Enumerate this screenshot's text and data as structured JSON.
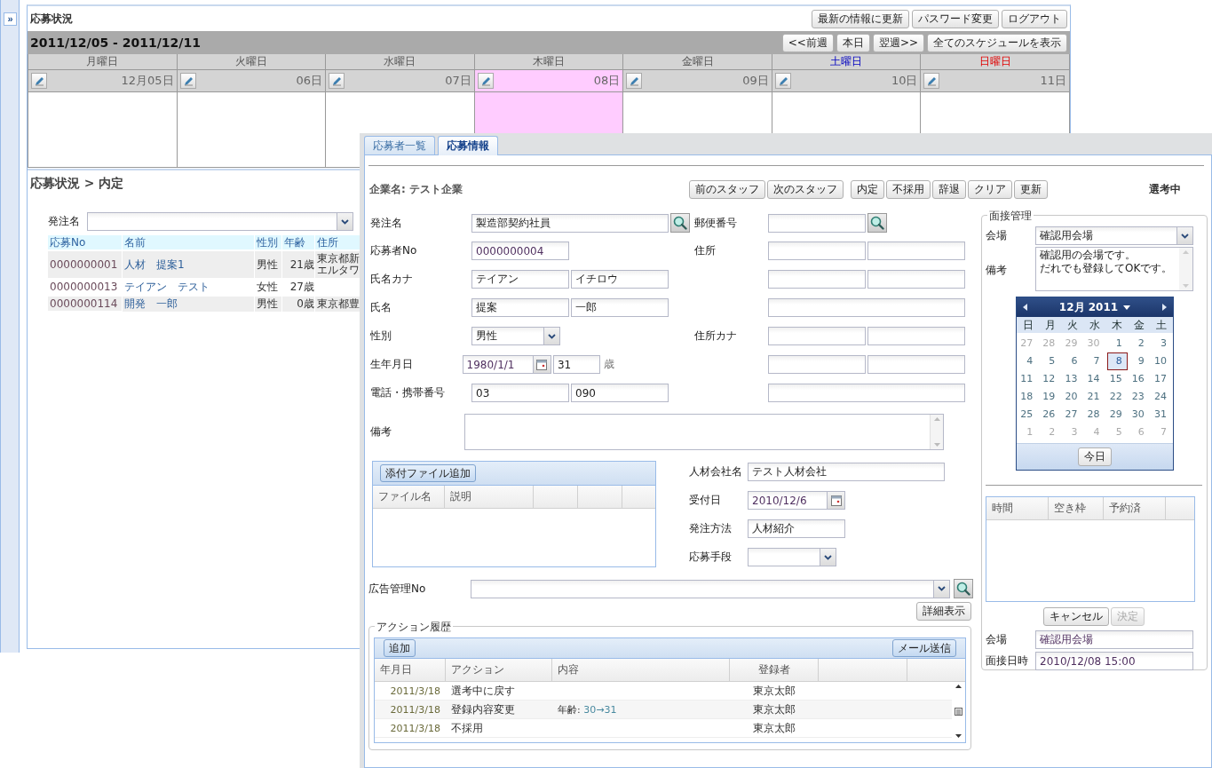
{
  "sidebar_toggle": {
    "label": "»"
  },
  "schedule": {
    "title": "応募状況",
    "buttons": [
      "最新の情報に更新",
      "パスワード変更",
      "ログアウト"
    ],
    "range": "2011/12/05 - 2011/12/11",
    "nav_buttons": [
      "<<前週",
      "本日",
      "翌週>>",
      "全てのスケジュールを表示"
    ],
    "days": [
      {
        "weekday": "月曜日",
        "date": "12月05日",
        "kind": "weekday",
        "selected": false
      },
      {
        "weekday": "火曜日",
        "date": "06日",
        "kind": "weekday",
        "selected": false
      },
      {
        "weekday": "水曜日",
        "date": "07日",
        "kind": "weekday",
        "selected": false
      },
      {
        "weekday": "木曜日",
        "date": "08日",
        "kind": "weekday",
        "selected": true
      },
      {
        "weekday": "金曜日",
        "date": "09日",
        "kind": "weekday",
        "selected": false
      },
      {
        "weekday": "土曜日",
        "date": "10日",
        "kind": "saturday",
        "selected": false
      },
      {
        "weekday": "日曜日",
        "date": "11日",
        "kind": "sunday",
        "selected": false
      }
    ]
  },
  "status": {
    "breadcrumb": "応募状況 > 内定",
    "filter_label": "発注名",
    "columns": [
      "応募No",
      "名前",
      "性別",
      "年齢",
      "住所"
    ],
    "rows": [
      {
        "no": "0000000001",
        "name": "人材　提案1",
        "gender": "男性",
        "age": "21歳",
        "address": [
          "東京都新",
          "エルタワ"
        ]
      },
      {
        "no": "0000000013",
        "name": "テイアン　テスト",
        "gender": "女性",
        "age": "27歳"
      },
      {
        "no": "0000000114",
        "name": "開発　一郎",
        "gender": "男性",
        "age": "0歳",
        "address": [
          "東京都豊"
        ]
      }
    ]
  },
  "dialog": {
    "tabs": [
      {
        "label": "応募者一覧",
        "selected": false
      },
      {
        "label": "応募情報",
        "selected": true
      }
    ],
    "company": "企業名: テスト企業",
    "button_groups": [
      [
        "前のスタッフ",
        "次のスタッフ"
      ],
      [
        "内定",
        "不採用",
        "辞退",
        "クリア",
        "更新"
      ]
    ],
    "state": "選考中",
    "person_fields": [
      {
        "label": "発注名",
        "kind": "search",
        "values": [
          "製造部契約社員"
        ]
      },
      {
        "label": "応募者No",
        "kind": "single",
        "values": [
          "0000000004"
        ]
      },
      {
        "label": "氏名カナ",
        "kind": "pair",
        "values": [
          "テイアン",
          "イチロウ"
        ]
      },
      {
        "label": "氏名",
        "kind": "pair",
        "values": [
          "提案",
          "一郎"
        ]
      },
      {
        "label": "性別",
        "kind": "select",
        "values": [
          "男性"
        ]
      },
      {
        "label": "生年月日",
        "kind": "date_age",
        "values": [
          "1980/1/1",
          "31"
        ],
        "suffix": "歳"
      },
      {
        "label": "電話・携帯番号",
        "kind": "pair",
        "values": [
          "03",
          "090"
        ]
      }
    ],
    "address_fields": [
      {
        "label": "郵便番号",
        "kind": "search"
      },
      {
        "label": "住所",
        "kind": "pair"
      },
      {
        "kind": "pair"
      },
      {
        "kind": "wide"
      },
      {
        "label": "住所カナ",
        "kind": "pair"
      },
      {
        "kind": "pair"
      },
      {
        "kind": "wide"
      }
    ],
    "remarks_label": "備考",
    "attachments": {
      "button": "添付ファイル追加",
      "columns": [
        "ファイル名",
        "説明"
      ]
    },
    "agency_fields": [
      {
        "label": "人材会社名",
        "kind": "wide",
        "value": "テスト人材会社"
      },
      {
        "label": "受付日",
        "kind": "date",
        "value": "2010/12/6"
      },
      {
        "label": "発注方法",
        "kind": "short",
        "value": "人材紹介"
      },
      {
        "label": "応募手段",
        "kind": "select"
      }
    ],
    "ad": {
      "label": "広告管理No",
      "detail_button": "詳細表示"
    },
    "history": {
      "title": "アクション履歴",
      "add_button": "追加",
      "mail_button": "メール送信",
      "columns": [
        "年月日",
        "アクション",
        "内容",
        "登録者"
      ],
      "rows": [
        {
          "date": "2011/3/18",
          "action": "選考中に戻す",
          "registrant": "東京太郎"
        },
        {
          "date": "2011/3/18",
          "action": "登録内容変更",
          "content_label": "年齢:",
          "content_value": "30→31",
          "registrant": "東京太郎"
        },
        {
          "date": "2011/3/18",
          "action": "不採用",
          "registrant": "東京太郎"
        }
      ]
    },
    "interview": {
      "title": "面接管理",
      "venue_label": "会場",
      "venue": "確認用会場",
      "note_label": "備考",
      "note_lines": [
        "確認用の会場です。",
        "だれでも登録してOKです。"
      ],
      "calendar": {
        "month": "12月 2011",
        "weekdays": [
          "日",
          "月",
          "火",
          "水",
          "木",
          "金",
          "土"
        ],
        "today_button": "今日",
        "days": [
          {
            "day": "27",
            "muted": true,
            "selected": false
          },
          {
            "day": "28",
            "muted": true,
            "selected": false
          },
          {
            "day": "29",
            "muted": true,
            "selected": false
          },
          {
            "day": "30",
            "muted": true,
            "selected": false
          },
          {
            "day": "1",
            "muted": false,
            "selected": false
          },
          {
            "day": "2",
            "muted": false,
            "selected": false
          },
          {
            "day": "3",
            "muted": false,
            "selected": false
          },
          {
            "day": "4",
            "muted": false,
            "selected": false
          },
          {
            "day": "5",
            "muted": false,
            "selected": false
          },
          {
            "day": "6",
            "muted": false,
            "selected": false
          },
          {
            "day": "7",
            "muted": false,
            "selected": false
          },
          {
            "day": "8",
            "muted": false,
            "selected": true
          },
          {
            "day": "9",
            "muted": false,
            "selected": false
          },
          {
            "day": "10",
            "muted": false,
            "selected": false
          },
          {
            "day": "11",
            "muted": false,
            "selected": false
          },
          {
            "day": "12",
            "muted": false,
            "selected": false
          },
          {
            "day": "13",
            "muted": false,
            "selected": false
          },
          {
            "day": "14",
            "muted": false,
            "selected": false
          },
          {
            "day": "15",
            "muted": false,
            "selected": false
          },
          {
            "day": "16",
            "muted": false,
            "selected": false
          },
          {
            "day": "17",
            "muted": false,
            "selected": false
          },
          {
            "day": "18",
            "muted": false,
            "selected": false
          },
          {
            "day": "19",
            "muted": false,
            "selected": false
          },
          {
            "day": "20",
            "muted": false,
            "selected": false
          },
          {
            "day": "21",
            "muted": false,
            "selected": false
          },
          {
            "day": "22",
            "muted": false,
            "selected": false
          },
          {
            "day": "23",
            "muted": false,
            "selected": false
          },
          {
            "day": "24",
            "muted": false,
            "selected": false
          },
          {
            "day": "25",
            "muted": false,
            "selected": false
          },
          {
            "day": "26",
            "muted": false,
            "selected": false
          },
          {
            "day": "27",
            "muted": false,
            "selected": false
          },
          {
            "day": "28",
            "muted": false,
            "selected": false
          },
          {
            "day": "29",
            "muted": false,
            "selected": false
          },
          {
            "day": "30",
            "muted": false,
            "selected": false
          },
          {
            "day": "31",
            "muted": false,
            "selected": false
          },
          {
            "day": "1",
            "muted": true,
            "selected": false
          },
          {
            "day": "2",
            "muted": true,
            "selected": false
          },
          {
            "day": "3",
            "muted": true,
            "selected": false
          },
          {
            "day": "4",
            "muted": true,
            "selected": false
          },
          {
            "day": "5",
            "muted": true,
            "selected": false
          },
          {
            "day": "6",
            "muted": true,
            "selected": false
          },
          {
            "day": "7",
            "muted": true,
            "selected": false
          }
        ]
      },
      "slot_columns": [
        "時間",
        "空き枠",
        "予約済"
      ],
      "cancel_button": "キャンセル",
      "confirm": {
        "label": "決定",
        "disabled": true
      },
      "summary": [
        {
          "label": "会場",
          "value": "確認用会場"
        },
        {
          "label": "面接日時",
          "value": "2010/12/08 15:00"
        }
      ]
    }
  }
}
